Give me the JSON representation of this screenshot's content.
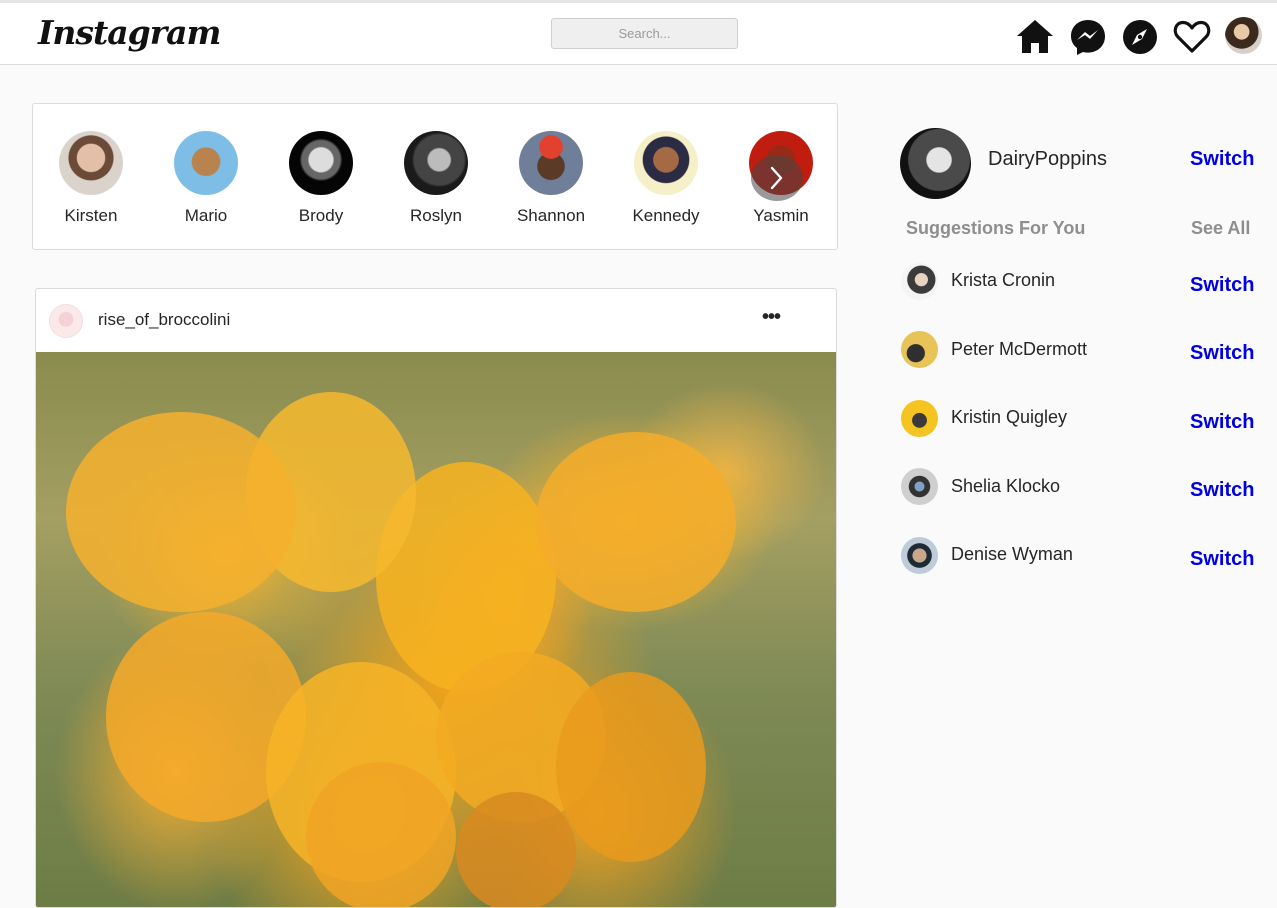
{
  "header": {
    "logo": "Instagram",
    "search_placeholder": "Search...",
    "icons": [
      "home-icon",
      "messenger-icon",
      "explore-icon",
      "heart-icon",
      "avatar"
    ]
  },
  "stories": [
    {
      "name": "Kirsten"
    },
    {
      "name": "Mario"
    },
    {
      "name": "Brody"
    },
    {
      "name": "Roslyn"
    },
    {
      "name": "Shannon"
    },
    {
      "name": "Kennedy"
    },
    {
      "name": "Yasmin"
    }
  ],
  "post": {
    "username": "rise_of_broccolini",
    "more": "•••"
  },
  "sidebar": {
    "username": "DairyPoppins",
    "switch_label": "Switch",
    "suggestions_title": "Suggestions For You",
    "see_all": "See All",
    "suggestions": [
      {
        "name": "Krista Cronin",
        "action": "Switch"
      },
      {
        "name": "Peter McDermott",
        "action": "Switch"
      },
      {
        "name": "Kristin Quigley",
        "action": "Switch"
      },
      {
        "name": "Shelia Klocko",
        "action": "Switch"
      },
      {
        "name": "Denise Wyman",
        "action": "Switch"
      }
    ]
  },
  "colors": {
    "link": "#0000e0",
    "muted": "#8e8e8e",
    "background": "#fafafa"
  }
}
